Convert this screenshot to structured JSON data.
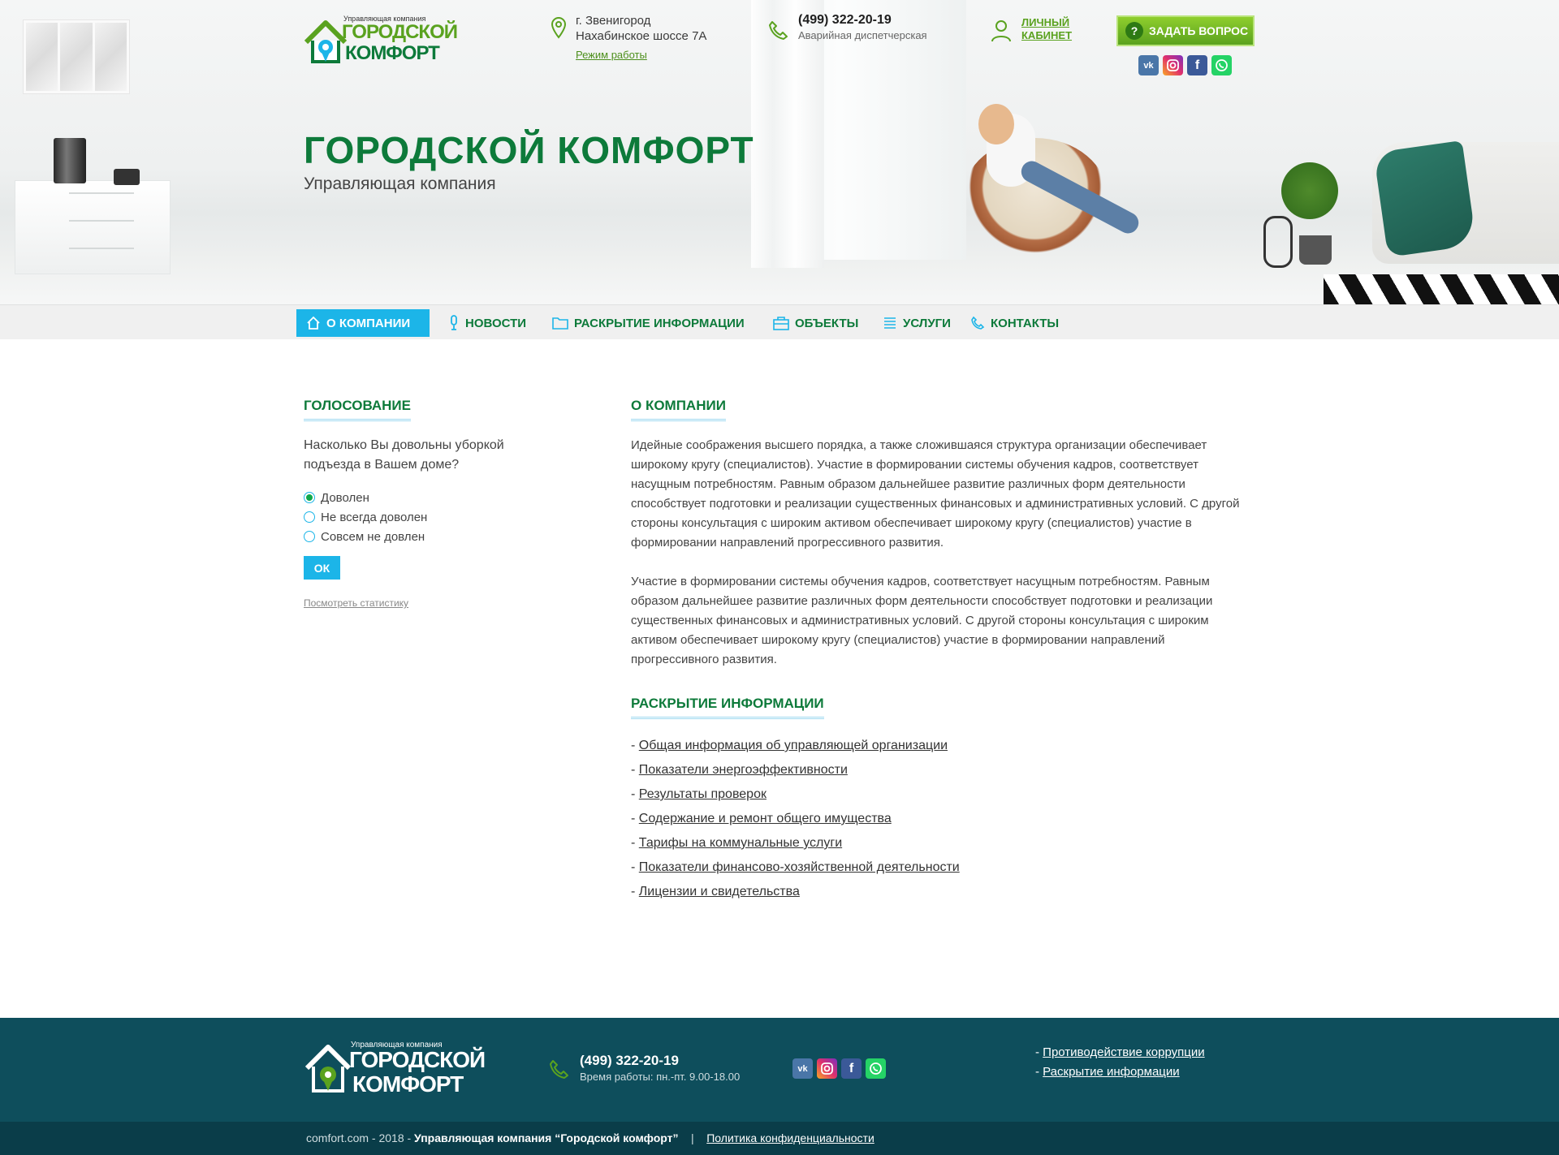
{
  "header": {
    "logo_small": "Управляющая компания",
    "logo_line1": "ГОРОДСКОЙ",
    "logo_line2": "КОМФОРТ",
    "address_city": "г. Звенигород",
    "address_street": "Нахабинское шоссе 7А",
    "work_mode_link": "Режим работы",
    "phone": "(499) 322-20-19",
    "phone_sub": "Аварийная диспетчерская",
    "cabinet_line1": "Личный",
    "cabinet_line2": "кабинет",
    "ask_button": "Задать вопрос",
    "socials": [
      "vk",
      "instagram",
      "facebook",
      "whatsapp"
    ]
  },
  "hero": {
    "title": "ГОРОДСКОЙ КОМФОРТ",
    "subtitle": "Управляющая компания"
  },
  "nav": {
    "items": [
      {
        "label": "О компании",
        "icon": "home-icon",
        "active": true
      },
      {
        "label": "Новости",
        "icon": "microphone-icon"
      },
      {
        "label": "Раскрытие информации",
        "icon": "folder-icon"
      },
      {
        "label": "Объекты",
        "icon": "building-icon"
      },
      {
        "label": "Услуги",
        "icon": "list-icon"
      },
      {
        "label": "Контакты",
        "icon": "phone-icon"
      }
    ]
  },
  "vote": {
    "title": "Голосование",
    "question": "Насколько Вы довольны уборкой подъезда в Вашем доме?",
    "options": [
      "Доволен",
      "Не всегда доволен",
      "Совсем не довлен"
    ],
    "selected": 0,
    "ok_button": "ОК",
    "stats_link": "Посмотреть статистику"
  },
  "about": {
    "title": "О компании",
    "paragraph1": "Идейные соображения высшего порядка, а также сложившаяся структура организации обеспечивает широкому кругу (специалистов). Участие в формировании системы обучения кадров, соответствует насущным потребностям. Равным образом дальнейшее развитие различных форм деятельности способствует подготовки и реализации существенных финансовых и административных условий. С другой стороны консультация с широким активом обеспечивает широкому кругу (специалистов) участие в формировании направлений прогрессивного развития.",
    "paragraph2": "Участие в формировании системы обучения кадров, соответствует насущным потребностям. Равным образом дальнейшее развитие различных форм деятельности способствует подготовки и реализации существенных финансовых и административных условий. С другой стороны консультация с широким активом обеспечивает широкому кругу (специалистов) участие в формировании направлений прогрессивного развития."
  },
  "disclosure": {
    "title": "Раскрытие информации",
    "links": [
      "Общая информация об управляющей организации",
      "Показатели энергоэффективности",
      "Результаты проверок",
      "Содержание и ремонт общего имущества",
      "Тарифы на коммунальные услуги",
      "Показатели финансово-хозяйственной деятельности",
      "Лицензии и свидетельства"
    ]
  },
  "footer": {
    "phone": "(499) 322-20-19",
    "hours": "Время работы: пн.-пт. 9.00-18.00",
    "links": [
      "Противодействие коррупции",
      "Раскрытие информации"
    ],
    "copyright_site": "comfort.com - 2018 - ",
    "copyright_name": "Управляющая компания “Городской комфорт”",
    "separator": "|",
    "privacy_link": "Политика конфиденциальности"
  },
  "colors": {
    "brand_green": "#0d7a3a",
    "accent_blue": "#1cb5e8",
    "lime": "#5aa21f",
    "footer_bg": "#0e4e5c"
  }
}
